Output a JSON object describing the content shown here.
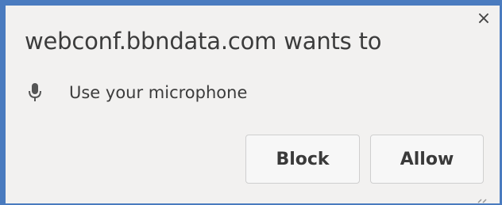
{
  "prompt": {
    "title": "webconf.bbndata.com wants to",
    "permission": {
      "icon": "microphone-icon",
      "label": "Use your microphone"
    },
    "buttons": {
      "block_label": "Block",
      "allow_label": "Allow"
    },
    "close_glyph": "×"
  },
  "colors": {
    "frame": "#4a7bbf",
    "dialog_background": "#f2f1f0",
    "text": "#3c3c3c",
    "button_background": "#f7f7f7",
    "button_border": "#cfcfcf"
  }
}
